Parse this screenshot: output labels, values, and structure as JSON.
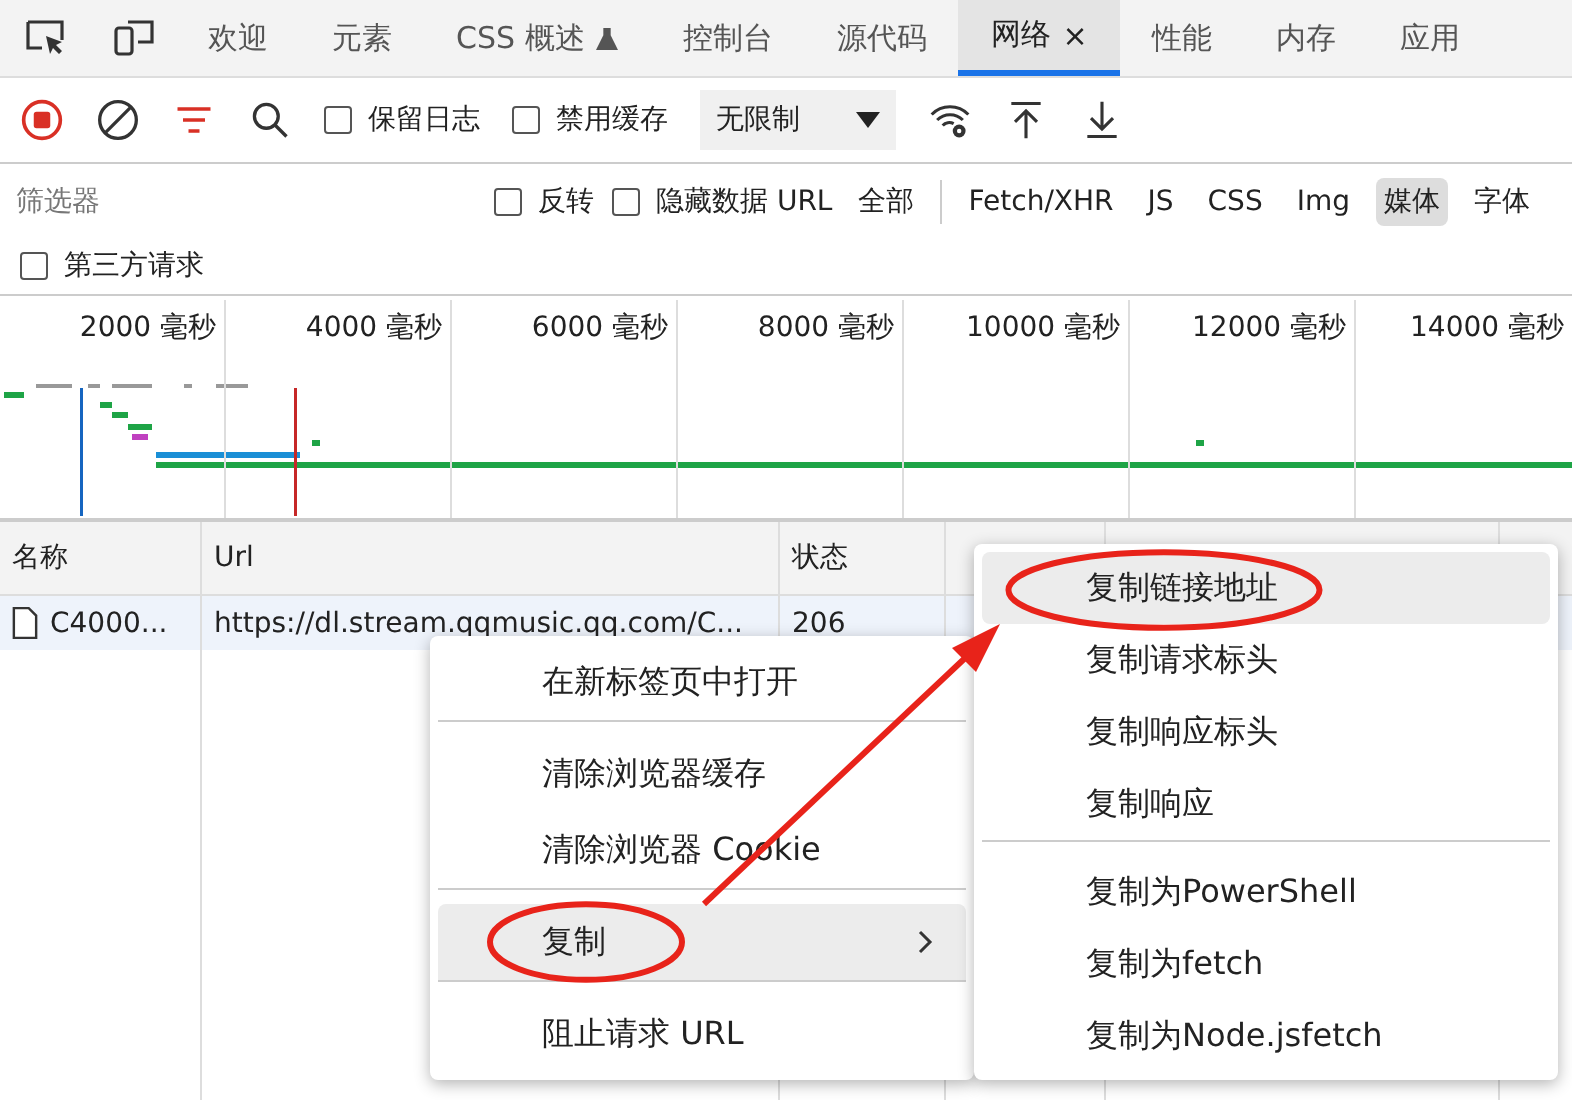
{
  "tabs": [
    {
      "label": "欢迎",
      "selected": false,
      "kind": "plain"
    },
    {
      "label": "元素",
      "selected": false,
      "kind": "plain"
    },
    {
      "label": "CSS 概述",
      "selected": false,
      "kind": "experimental"
    },
    {
      "label": "控制台",
      "selected": false,
      "kind": "plain"
    },
    {
      "label": "源代码",
      "selected": false,
      "kind": "plain"
    },
    {
      "label": "网络",
      "selected": true,
      "kind": "plain",
      "close": "×"
    },
    {
      "label": "性能",
      "selected": false,
      "kind": "plain"
    },
    {
      "label": "内存",
      "selected": false,
      "kind": "plain"
    },
    {
      "label": "应用",
      "selected": false,
      "kind": "plain"
    }
  ],
  "toolbar": {
    "recording": true,
    "checkboxes": [
      {
        "label": "保留日志",
        "checked": false
      },
      {
        "label": "禁用缓存",
        "checked": false
      }
    ],
    "throttle": "无限制"
  },
  "filter": {
    "placeholder": "筛选器",
    "checkboxes": [
      {
        "label": "反转",
        "checked": false
      },
      {
        "label": "隐藏数据 URL",
        "checked": false
      }
    ],
    "types": [
      {
        "label": "全部",
        "selected": false
      },
      {
        "label": "Fetch/XHR",
        "selected": false
      },
      {
        "label": "JS",
        "selected": false
      },
      {
        "label": "CSS",
        "selected": false
      },
      {
        "label": "Img",
        "selected": false
      },
      {
        "label": "媒体",
        "selected": true
      },
      {
        "label": "字体",
        "selected": false
      }
    ],
    "third_party": {
      "label": "第三方请求",
      "checked": false
    }
  },
  "timeline": {
    "ticks": [
      "2000 毫秒",
      "4000 毫秒",
      "6000 毫秒",
      "8000 毫秒",
      "10000 毫秒",
      "12000 毫秒",
      "14000 毫秒"
    ]
  },
  "table": {
    "columns": [
      "名称",
      "Url",
      "状态"
    ],
    "rows": [
      {
        "name": "C4000...",
        "url": "https://dl.stream.qqmusic.qq.com/C...",
        "status": "206"
      }
    ]
  },
  "context_menu": {
    "items": [
      {
        "label": "在新标签页中打开",
        "highlighted": false,
        "circled": false,
        "submenu": false,
        "divider_after": true
      },
      {
        "label": "清除浏览器缓存",
        "highlighted": false,
        "circled": false,
        "submenu": false,
        "divider_after": false
      },
      {
        "label": "清除浏览器 Cookie",
        "highlighted": false,
        "circled": false,
        "submenu": false,
        "divider_after": true
      },
      {
        "label": "复制",
        "highlighted": true,
        "circled": true,
        "submenu": true,
        "divider_after": true
      },
      {
        "label": "阻止请求 URL",
        "highlighted": false,
        "circled": false,
        "submenu": false,
        "divider_after": false
      }
    ]
  },
  "submenu": {
    "items": [
      {
        "label": "复制链接地址",
        "highlighted": true,
        "circled": true,
        "divider_after": false
      },
      {
        "label": "复制请求标头",
        "highlighted": false,
        "circled": false,
        "divider_after": false
      },
      {
        "label": "复制响应标头",
        "highlighted": false,
        "circled": false,
        "divider_after": false
      },
      {
        "label": "复制响应",
        "highlighted": false,
        "circled": false,
        "divider_after": true
      },
      {
        "label": "复制为PowerShell",
        "highlighted": false,
        "circled": false,
        "divider_after": false
      },
      {
        "label": "复制为fetch",
        "highlighted": false,
        "circled": false,
        "divider_after": false
      },
      {
        "label": "复制为Node.jsfetch",
        "highlighted": false,
        "circled": false,
        "divider_after": false
      }
    ]
  },
  "annotations": {
    "arrow": true
  }
}
